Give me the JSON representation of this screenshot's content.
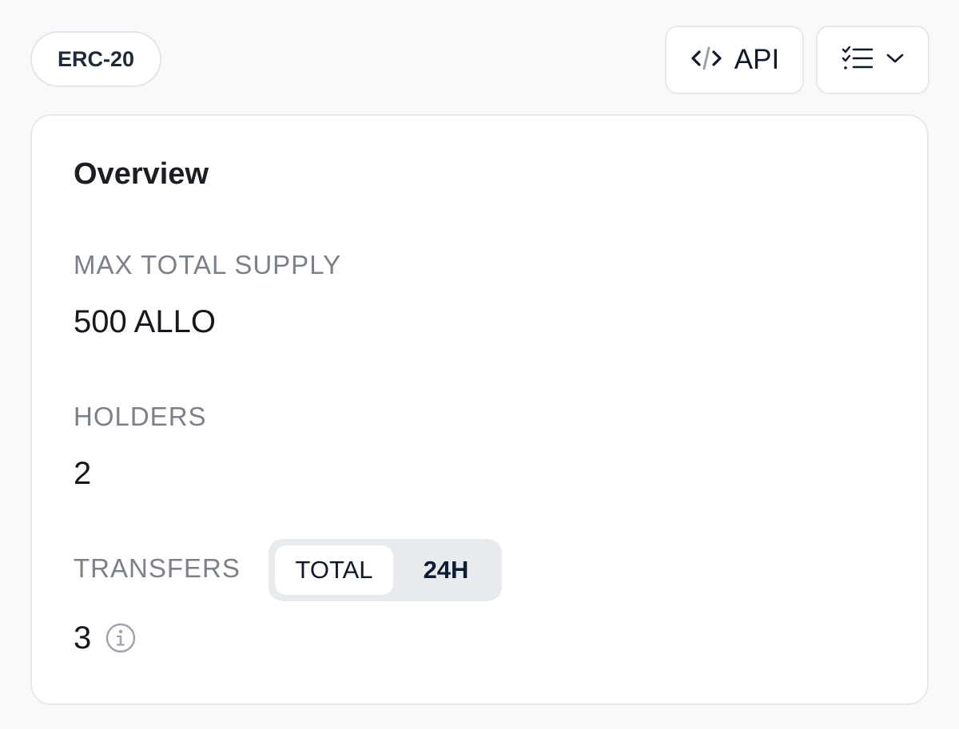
{
  "header": {
    "token_standard_badge": "ERC-20",
    "api_button_label": "API",
    "api_icon": "code-icon",
    "menu_icon": "checklist-icon",
    "menu_chevron_icon": "chevron-down-icon"
  },
  "overview": {
    "title": "Overview",
    "max_total_supply": {
      "label": "MAX TOTAL SUPPLY",
      "value": "500 ALLO"
    },
    "holders": {
      "label": "HOLDERS",
      "value": "2"
    },
    "transfers": {
      "label": "TRANSFERS",
      "value": "3",
      "info_icon": "info-icon",
      "toggle": {
        "options": [
          "TOTAL",
          "24H"
        ],
        "selected": "TOTAL"
      }
    }
  }
}
